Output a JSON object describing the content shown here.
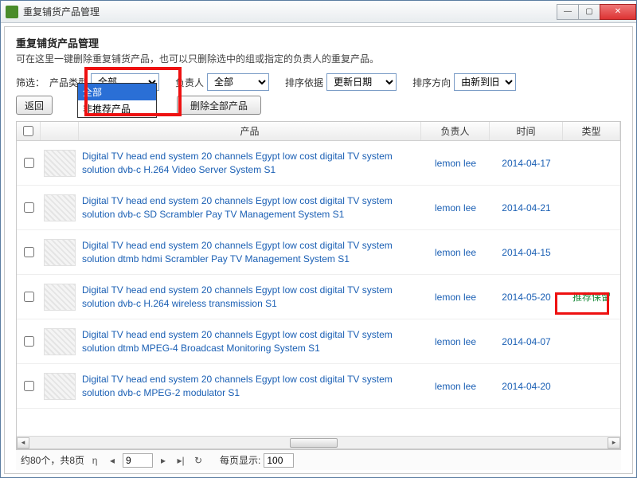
{
  "window": {
    "title": "重复铺货产品管理"
  },
  "header": {
    "title": "重复铺货产品管理",
    "subtitle": "可在这里一键删除重复铺货产品，也可以只删除选中的组或指定的负责人的重复产品。"
  },
  "filter": {
    "label": "筛选：",
    "productTypeLabel": "产品类型",
    "productTypeValue": "全部",
    "dropdownOptions": [
      "全部",
      "非推荐产品"
    ],
    "ownerLabel": "负责人",
    "ownerValue": "全部",
    "sortByLabel": "排序依据",
    "sortByValue": "更新日期",
    "sortDirLabel": "排序方向",
    "sortDirValue": "由新到旧"
  },
  "buttons": {
    "back": "返回",
    "deleteAll": "删除全部产品"
  },
  "table": {
    "headers": {
      "product": "产品",
      "owner": "负责人",
      "time": "时间",
      "type": "类型"
    },
    "rows": [
      {
        "product": "Digital TV head end system 20 channels Egypt low cost digital TV system solution dvb-c H.264 Video Server System S1",
        "owner": "lemon lee",
        "time": "2014-04-17",
        "type": ""
      },
      {
        "product": "Digital TV head end system 20 channels Egypt low cost digital TV system solution dvb-c SD Scrambler Pay TV Management System S1",
        "owner": "lemon lee",
        "time": "2014-04-21",
        "type": ""
      },
      {
        "product": "Digital TV head end system 20 channels Egypt low cost digital TV system solution dtmb hdmi Scrambler Pay TV Management System S1",
        "owner": "lemon lee",
        "time": "2014-04-15",
        "type": ""
      },
      {
        "product": "Digital TV head end system 20 channels Egypt low cost digital TV system solution dvb-c H.264 wireless transmission S1",
        "owner": "lemon lee",
        "time": "2014-05-20",
        "type": "推荐保留"
      },
      {
        "product": "Digital TV head end system 20 channels Egypt low cost digital TV system solution dtmb MPEG-4 Broadcast Monitoring System S1",
        "owner": "lemon lee",
        "time": "2014-04-07",
        "type": ""
      },
      {
        "product": "Digital TV head end system 20 channels Egypt low cost digital TV system solution dvb-c MPEG-2 modulator S1",
        "owner": "lemon lee",
        "time": "2014-04-20",
        "type": ""
      }
    ]
  },
  "pager": {
    "summary": "约80个，共8页",
    "page": "9",
    "perPageLabel": "每页显示:",
    "perPage": "100"
  }
}
